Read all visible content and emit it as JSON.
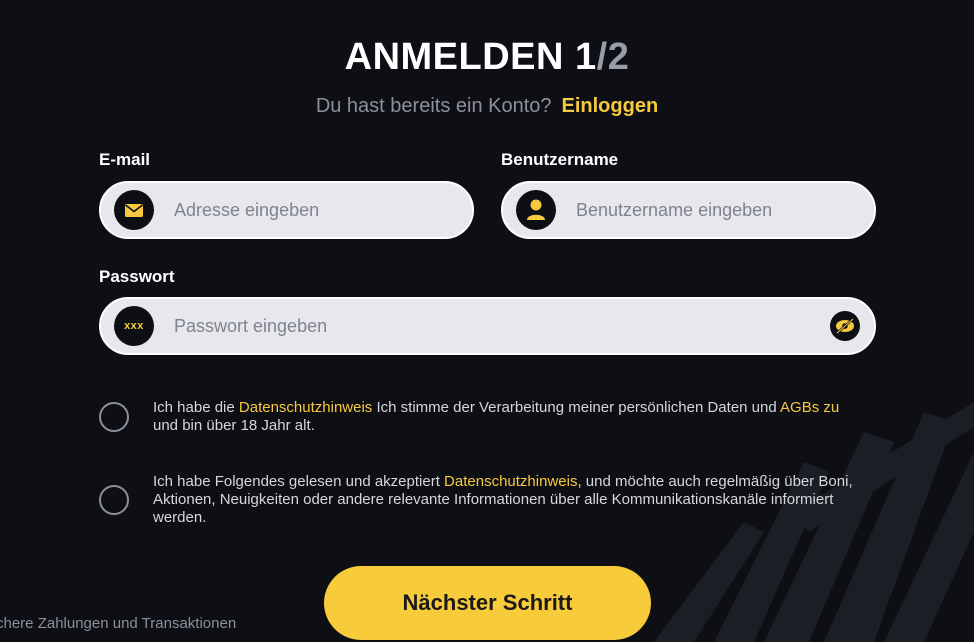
{
  "title": {
    "main": "ANMELDEN 1",
    "separator": "/",
    "total": "2"
  },
  "subtitle": {
    "text": "Du hast bereits ein Konto?",
    "login_link": "Einloggen"
  },
  "email": {
    "label": "E-mail",
    "placeholder": "Adresse eingeben",
    "icon": "envelope-icon"
  },
  "username": {
    "label": "Benutzername",
    "placeholder": "Benutzername eingeben",
    "icon": "user-icon"
  },
  "password": {
    "label": "Passwort",
    "placeholder": "Passwort eingeben",
    "icon": "password-xxx-icon",
    "toggle_icon": "eye-off-icon",
    "icon_text": "xxx"
  },
  "consent1": {
    "part1": "Ich habe die ",
    "link1": "Datenschutzhinweis",
    "part2": " Ich stimme der Verarbeitung meiner persönlichen Daten und ",
    "link2": "AGBs zu",
    "part3": " und bin über 18 Jahr alt."
  },
  "consent2": {
    "part1": "Ich habe Folgendes gelesen und akzeptiert ",
    "link1": "Datenschutzhinweis",
    "part2": ", und möchte auch regelmäßig über Boni, Aktionen, Neuigkeiten oder andere relevante Informationen über alle Kommunikationskanäle informiert werden."
  },
  "next_button": "Nächster Schritt",
  "footer_note": "chere Zahlungen und Transaktionen",
  "colors": {
    "accent": "#f7cb3a",
    "background": "#0d0f15",
    "field": "#e7e8ed"
  }
}
